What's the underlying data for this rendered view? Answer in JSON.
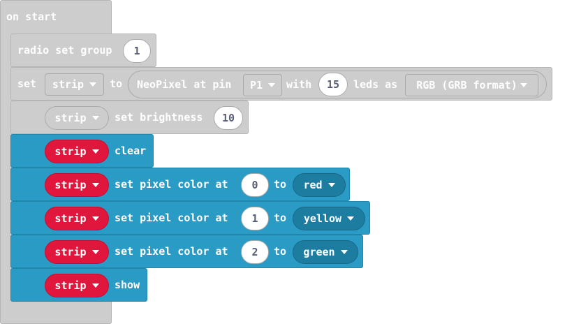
{
  "on_start": {
    "label": "on start"
  },
  "radio": {
    "label": "radio set group",
    "value": "1"
  },
  "set_strip": {
    "set_label": "set",
    "var": "strip",
    "to_label": "to",
    "neopixel_label": "NeoPixel at pin",
    "pin": "P1",
    "with_label": "with",
    "leds": "15",
    "leds_as_label": "leds as",
    "format": "RGB (GRB format)"
  },
  "brightness": {
    "var": "strip",
    "label": "set brightness",
    "value": "10"
  },
  "clear": {
    "var": "strip",
    "label": "clear"
  },
  "pixels": [
    {
      "var": "strip",
      "label": "set pixel color at",
      "index": "0",
      "to_label": "to",
      "color": "red"
    },
    {
      "var": "strip",
      "label": "set pixel color at",
      "index": "1",
      "to_label": "to",
      "color": "yellow"
    },
    {
      "var": "strip",
      "label": "set pixel color at",
      "index": "2",
      "to_label": "to",
      "color": "green"
    }
  ],
  "show": {
    "var": "strip",
    "label": "show"
  },
  "colors": {
    "neopixel_blue": "#2a9bc4",
    "variable_red": "#e0163d",
    "disabled_grey": "#cdcdcd"
  }
}
